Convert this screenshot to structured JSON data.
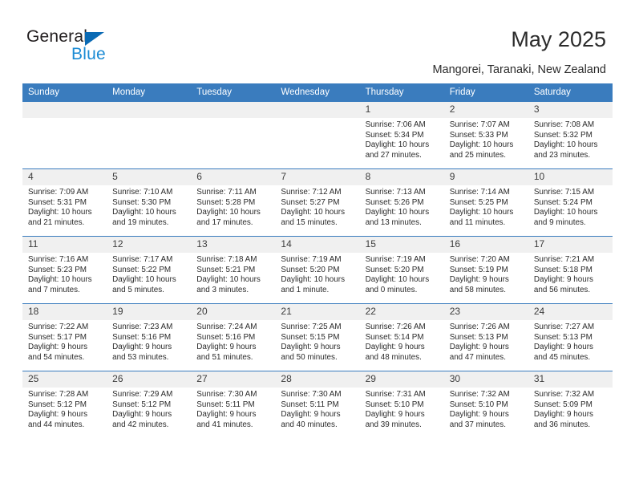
{
  "brand": {
    "name_top": "General",
    "name_bottom": "Blue",
    "accent_color": "#1b8bd4",
    "triangle_color": "#0a6ab4"
  },
  "header": {
    "title": "May 2025",
    "subtitle": "Mangorei, Taranaki, New Zealand",
    "header_bg": "#3a7cbe",
    "header_text_color": "#ffffff"
  },
  "weekday_headers": [
    "Sunday",
    "Monday",
    "Tuesday",
    "Wednesday",
    "Thursday",
    "Friday",
    "Saturday"
  ],
  "labels": {
    "sunrise_prefix": "Sunrise:",
    "sunset_prefix": "Sunset:",
    "daylight_prefix": "Daylight:"
  },
  "weeks": [
    [
      {
        "day": "",
        "empty": true
      },
      {
        "day": "",
        "empty": true
      },
      {
        "day": "",
        "empty": true
      },
      {
        "day": "",
        "empty": true
      },
      {
        "day": "1",
        "sunrise": "Sunrise: 7:06 AM",
        "sunset": "Sunset: 5:34 PM",
        "daylight": "Daylight: 10 hours and 27 minutes."
      },
      {
        "day": "2",
        "sunrise": "Sunrise: 7:07 AM",
        "sunset": "Sunset: 5:33 PM",
        "daylight": "Daylight: 10 hours and 25 minutes."
      },
      {
        "day": "3",
        "sunrise": "Sunrise: 7:08 AM",
        "sunset": "Sunset: 5:32 PM",
        "daylight": "Daylight: 10 hours and 23 minutes."
      }
    ],
    [
      {
        "day": "4",
        "sunrise": "Sunrise: 7:09 AM",
        "sunset": "Sunset: 5:31 PM",
        "daylight": "Daylight: 10 hours and 21 minutes."
      },
      {
        "day": "5",
        "sunrise": "Sunrise: 7:10 AM",
        "sunset": "Sunset: 5:30 PM",
        "daylight": "Daylight: 10 hours and 19 minutes."
      },
      {
        "day": "6",
        "sunrise": "Sunrise: 7:11 AM",
        "sunset": "Sunset: 5:28 PM",
        "daylight": "Daylight: 10 hours and 17 minutes."
      },
      {
        "day": "7",
        "sunrise": "Sunrise: 7:12 AM",
        "sunset": "Sunset: 5:27 PM",
        "daylight": "Daylight: 10 hours and 15 minutes."
      },
      {
        "day": "8",
        "sunrise": "Sunrise: 7:13 AM",
        "sunset": "Sunset: 5:26 PM",
        "daylight": "Daylight: 10 hours and 13 minutes."
      },
      {
        "day": "9",
        "sunrise": "Sunrise: 7:14 AM",
        "sunset": "Sunset: 5:25 PM",
        "daylight": "Daylight: 10 hours and 11 minutes."
      },
      {
        "day": "10",
        "sunrise": "Sunrise: 7:15 AM",
        "sunset": "Sunset: 5:24 PM",
        "daylight": "Daylight: 10 hours and 9 minutes."
      }
    ],
    [
      {
        "day": "11",
        "sunrise": "Sunrise: 7:16 AM",
        "sunset": "Sunset: 5:23 PM",
        "daylight": "Daylight: 10 hours and 7 minutes."
      },
      {
        "day": "12",
        "sunrise": "Sunrise: 7:17 AM",
        "sunset": "Sunset: 5:22 PM",
        "daylight": "Daylight: 10 hours and 5 minutes."
      },
      {
        "day": "13",
        "sunrise": "Sunrise: 7:18 AM",
        "sunset": "Sunset: 5:21 PM",
        "daylight": "Daylight: 10 hours and 3 minutes."
      },
      {
        "day": "14",
        "sunrise": "Sunrise: 7:19 AM",
        "sunset": "Sunset: 5:20 PM",
        "daylight": "Daylight: 10 hours and 1 minute."
      },
      {
        "day": "15",
        "sunrise": "Sunrise: 7:19 AM",
        "sunset": "Sunset: 5:20 PM",
        "daylight": "Daylight: 10 hours and 0 minutes."
      },
      {
        "day": "16",
        "sunrise": "Sunrise: 7:20 AM",
        "sunset": "Sunset: 5:19 PM",
        "daylight": "Daylight: 9 hours and 58 minutes."
      },
      {
        "day": "17",
        "sunrise": "Sunrise: 7:21 AM",
        "sunset": "Sunset: 5:18 PM",
        "daylight": "Daylight: 9 hours and 56 minutes."
      }
    ],
    [
      {
        "day": "18",
        "sunrise": "Sunrise: 7:22 AM",
        "sunset": "Sunset: 5:17 PM",
        "daylight": "Daylight: 9 hours and 54 minutes."
      },
      {
        "day": "19",
        "sunrise": "Sunrise: 7:23 AM",
        "sunset": "Sunset: 5:16 PM",
        "daylight": "Daylight: 9 hours and 53 minutes."
      },
      {
        "day": "20",
        "sunrise": "Sunrise: 7:24 AM",
        "sunset": "Sunset: 5:16 PM",
        "daylight": "Daylight: 9 hours and 51 minutes."
      },
      {
        "day": "21",
        "sunrise": "Sunrise: 7:25 AM",
        "sunset": "Sunset: 5:15 PM",
        "daylight": "Daylight: 9 hours and 50 minutes."
      },
      {
        "day": "22",
        "sunrise": "Sunrise: 7:26 AM",
        "sunset": "Sunset: 5:14 PM",
        "daylight": "Daylight: 9 hours and 48 minutes."
      },
      {
        "day": "23",
        "sunrise": "Sunrise: 7:26 AM",
        "sunset": "Sunset: 5:13 PM",
        "daylight": "Daylight: 9 hours and 47 minutes."
      },
      {
        "day": "24",
        "sunrise": "Sunrise: 7:27 AM",
        "sunset": "Sunset: 5:13 PM",
        "daylight": "Daylight: 9 hours and 45 minutes."
      }
    ],
    [
      {
        "day": "25",
        "sunrise": "Sunrise: 7:28 AM",
        "sunset": "Sunset: 5:12 PM",
        "daylight": "Daylight: 9 hours and 44 minutes."
      },
      {
        "day": "26",
        "sunrise": "Sunrise: 7:29 AM",
        "sunset": "Sunset: 5:12 PM",
        "daylight": "Daylight: 9 hours and 42 minutes."
      },
      {
        "day": "27",
        "sunrise": "Sunrise: 7:30 AM",
        "sunset": "Sunset: 5:11 PM",
        "daylight": "Daylight: 9 hours and 41 minutes."
      },
      {
        "day": "28",
        "sunrise": "Sunrise: 7:30 AM",
        "sunset": "Sunset: 5:11 PM",
        "daylight": "Daylight: 9 hours and 40 minutes."
      },
      {
        "day": "29",
        "sunrise": "Sunrise: 7:31 AM",
        "sunset": "Sunset: 5:10 PM",
        "daylight": "Daylight: 9 hours and 39 minutes."
      },
      {
        "day": "30",
        "sunrise": "Sunrise: 7:32 AM",
        "sunset": "Sunset: 5:10 PM",
        "daylight": "Daylight: 9 hours and 37 minutes."
      },
      {
        "day": "31",
        "sunrise": "Sunrise: 7:32 AM",
        "sunset": "Sunset: 5:09 PM",
        "daylight": "Daylight: 9 hours and 36 minutes."
      }
    ]
  ]
}
